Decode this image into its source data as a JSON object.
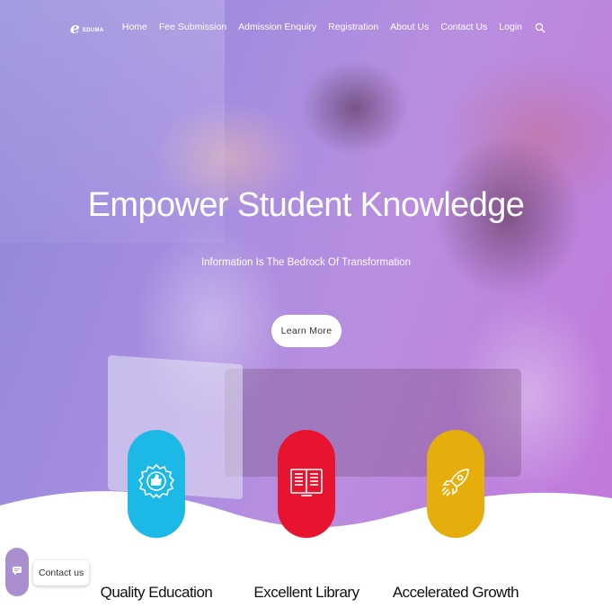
{
  "brand": {
    "name": "EDUMA",
    "logo_letter": "e"
  },
  "nav": {
    "items": [
      {
        "label": "Home"
      },
      {
        "label": "Fee Submission"
      },
      {
        "label": "Admission Enquiry"
      },
      {
        "label": "Registration"
      },
      {
        "label": "About Us"
      },
      {
        "label": "Contact Us"
      },
      {
        "label": "Login"
      }
    ],
    "search_icon": "search-icon"
  },
  "hero": {
    "title": "Empower Student Knowledge",
    "subtitle": "Information Is The Bedrock Of Transformation",
    "button_label": "Learn More"
  },
  "features": [
    {
      "label": "Quality Education",
      "icon": "award-badge-icon",
      "color": "#1db9e6"
    },
    {
      "label": "Excellent Library",
      "icon": "book-icon",
      "color": "#e8142f"
    },
    {
      "label": "Accelerated Growth",
      "icon": "rocket-icon",
      "color": "#e5ae0c"
    }
  ],
  "chat": {
    "label": "Contact us",
    "icon": "chat-icon"
  },
  "colors": {
    "accent": "#a98ed0",
    "overlay_start": "#8f86d9",
    "overlay_end": "#c278db"
  }
}
